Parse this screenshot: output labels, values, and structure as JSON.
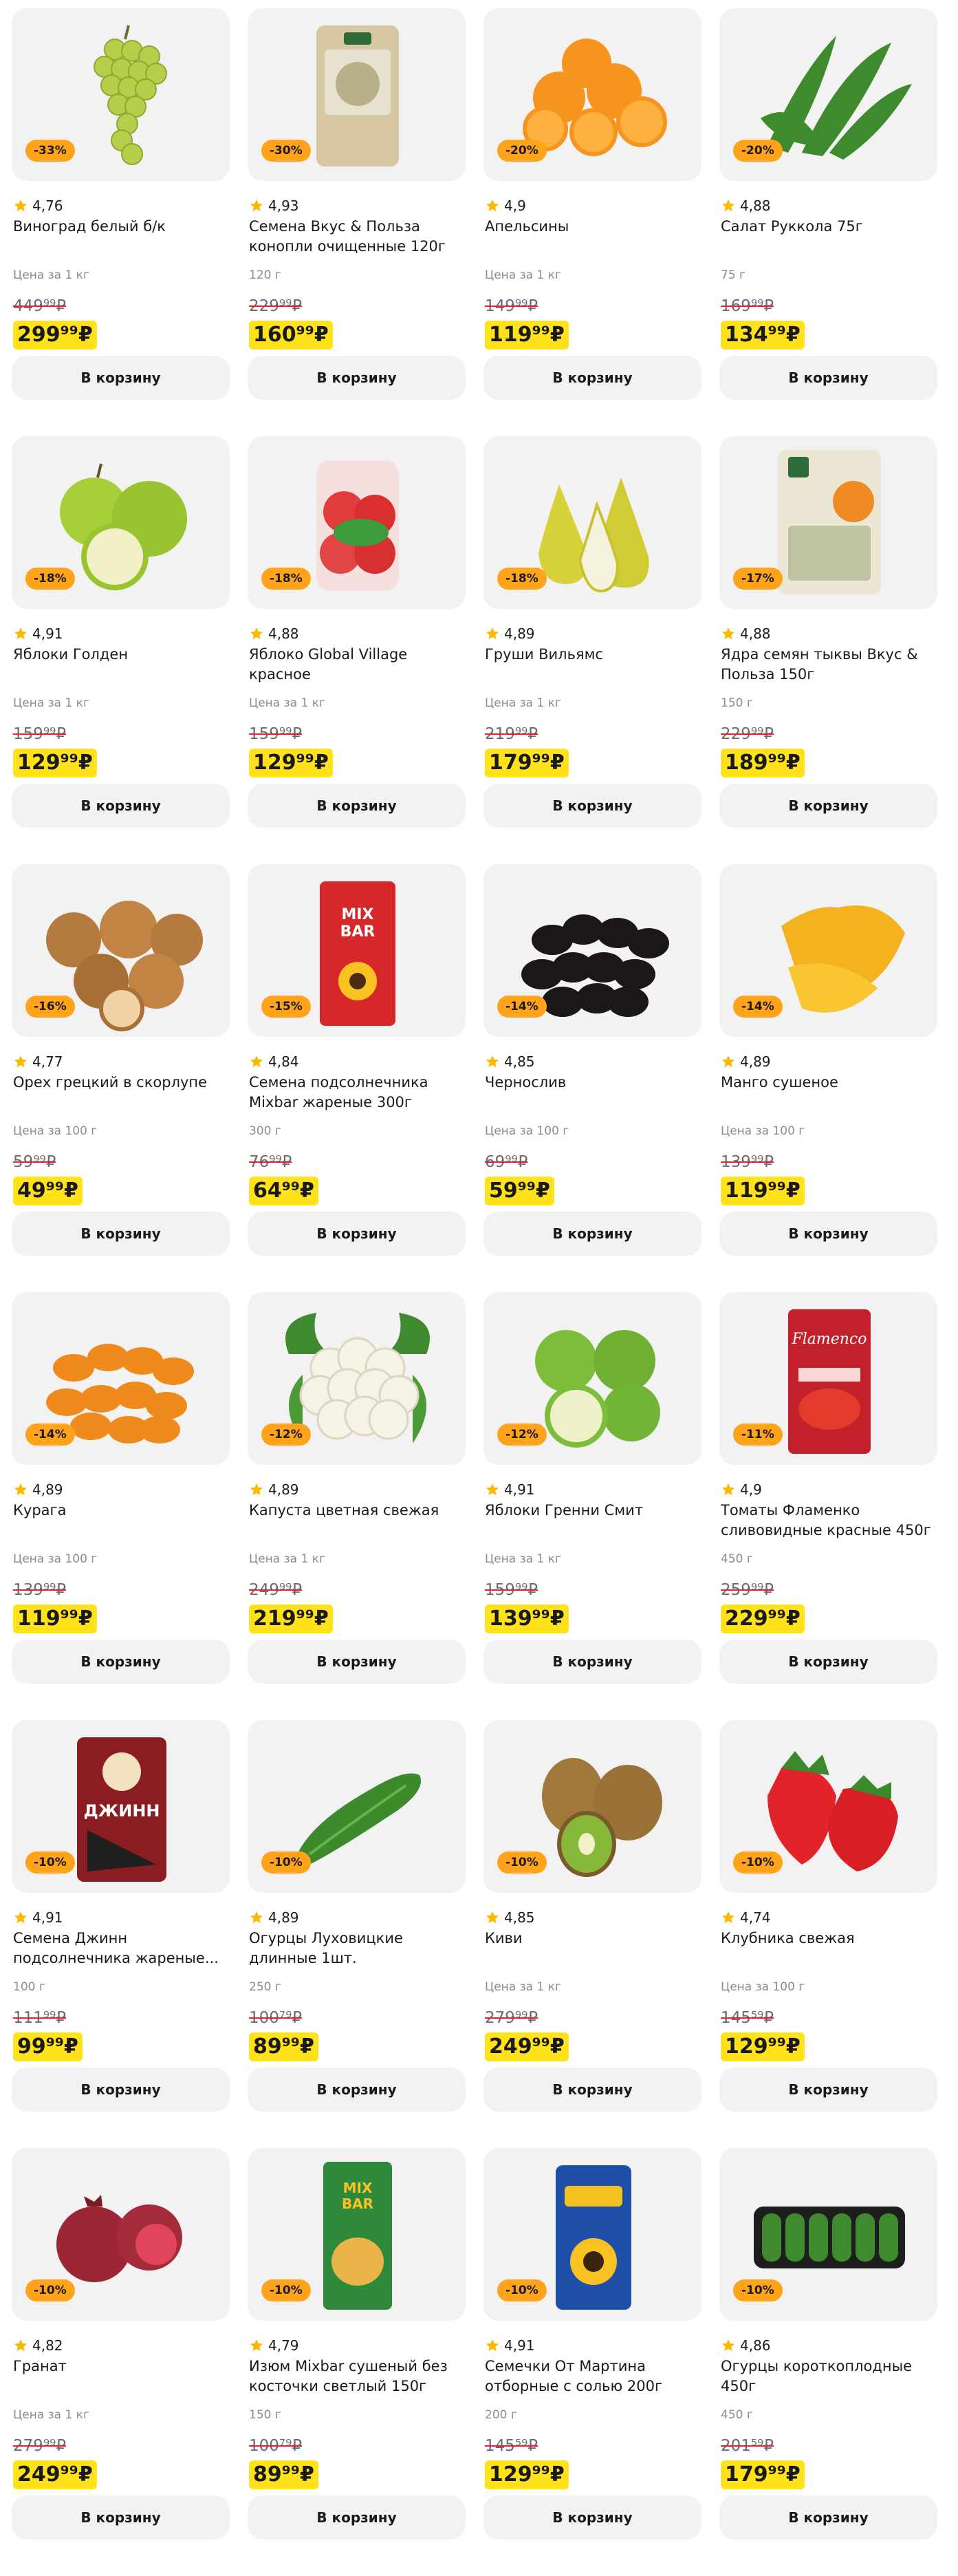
{
  "cart_label": "В корзину",
  "colors": {
    "discount": "#ffa31a",
    "price_highlight": "#ffe21a",
    "star": "#ffb800",
    "strike": "#e0262f",
    "card_bg": "#f2f2f2"
  },
  "products": [
    {
      "icon": "grapes",
      "discount": "-33%",
      "rating": "4,76",
      "title": "Виноград белый б/к",
      "unit": "Цена за 1 кг",
      "old_price": "449⁹⁹₽",
      "new_price": "299⁹⁹₽"
    },
    {
      "icon": "seed-pack",
      "discount": "-30%",
      "rating": "4,93",
      "title": "Семена Вкус & Польза конопли очищенные 120г",
      "unit": "120 г",
      "old_price": "229⁹⁹₽",
      "new_price": "160⁹⁹₽"
    },
    {
      "icon": "oranges",
      "discount": "-20%",
      "rating": "4,9",
      "title": "Апельсины",
      "unit": "Цена за 1 кг",
      "old_price": "149⁹⁹₽",
      "new_price": "119⁹⁹₽"
    },
    {
      "icon": "arugula",
      "discount": "-20%",
      "rating": "4,88",
      "title": "Салат Руккола 75г",
      "unit": "75 г",
      "old_price": "169⁹⁹₽",
      "new_price": "134⁹⁹₽"
    },
    {
      "icon": "green-apples",
      "discount": "-18%",
      "rating": "4,91",
      "title": "Яблоки Голден",
      "unit": "Цена за 1 кг",
      "old_price": "159⁹⁹₽",
      "new_price": "129⁹⁹₽"
    },
    {
      "icon": "red-apples-bag",
      "discount": "-18%",
      "rating": "4,88",
      "title": "Яблоко Global Village красное",
      "unit": "Цена за 1 кг",
      "old_price": "159⁹⁹₽",
      "new_price": "129⁹⁹₽"
    },
    {
      "icon": "pears",
      "discount": "-18%",
      "rating": "4,89",
      "title": "Груши Вильямс",
      "unit": "Цена за 1 кг",
      "old_price": "219⁹⁹₽",
      "new_price": "179⁹⁹₽"
    },
    {
      "icon": "pumpkin-seed-pack",
      "discount": "-17%",
      "rating": "4,88",
      "title": "Ядра семян тыквы Вкус & Польза 150г",
      "unit": "150 г",
      "old_price": "229⁹⁹₽",
      "new_price": "189⁹⁹₽"
    },
    {
      "icon": "walnuts",
      "discount": "-16%",
      "rating": "4,77",
      "title": "Орех грецкий в скорлупе",
      "unit": "Цена за 100 г",
      "old_price": "59⁹⁹₽",
      "new_price": "49⁹⁹₽"
    },
    {
      "icon": "mixbar-red-pack",
      "discount": "-15%",
      "rating": "4,84",
      "title": "Семена подсолнечника Mixbar жареные 300г",
      "unit": "300 г",
      "old_price": "76⁹⁹₽",
      "new_price": "64⁹⁹₽"
    },
    {
      "icon": "prunes",
      "discount": "-14%",
      "rating": "4,85",
      "title": "Чернослив",
      "unit": "Цена за 100 г",
      "old_price": "69⁹⁹₽",
      "new_price": "59⁹⁹₽"
    },
    {
      "icon": "dried-mango",
      "discount": "-14%",
      "rating": "4,89",
      "title": "Манго сушеное",
      "unit": "Цена за 100 г",
      "old_price": "139⁹⁹₽",
      "new_price": "119⁹⁹₽"
    },
    {
      "icon": "dried-apricots",
      "discount": "-14%",
      "rating": "4,89",
      "title": "Курага",
      "unit": "Цена за 100 г",
      "old_price": "139⁹⁹₽",
      "new_price": "119⁹⁹₽"
    },
    {
      "icon": "cauliflower",
      "discount": "-12%",
      "rating": "4,89",
      "title": "Капуста цветная свежая",
      "unit": "Цена за 1 кг",
      "old_price": "249⁹⁹₽",
      "new_price": "219⁹⁹₽"
    },
    {
      "icon": "granny-apples",
      "discount": "-12%",
      "rating": "4,91",
      "title": "Яблоки Гренни Смит",
      "unit": "Цена за 1 кг",
      "old_price": "159⁹⁹₽",
      "new_price": "139⁹⁹₽"
    },
    {
      "icon": "tomato-pack",
      "discount": "-11%",
      "rating": "4,9",
      "title": "Томаты Фламенко сливовидные красные 450г",
      "unit": "450 г",
      "old_price": "259⁹⁹₽",
      "new_price": "229⁹⁹₽"
    },
    {
      "icon": "djinn-seed-pack",
      "discount": "-10%",
      "rating": "4,91",
      "title": "Семена Джинн подсолнечника жареные...",
      "unit": "100 г",
      "old_price": "111⁹⁹₽",
      "new_price": "99⁹⁹₽"
    },
    {
      "icon": "cucumber",
      "discount": "-10%",
      "rating": "4,89",
      "title": "Огурцы Луховицкие длинные 1шт.",
      "unit": "250 г",
      "old_price": "100⁷⁹₽",
      "new_price": "89⁹⁹₽"
    },
    {
      "icon": "kiwi",
      "discount": "-10%",
      "rating": "4,85",
      "title": "Киви",
      "unit": "Цена за 1 кг",
      "old_price": "279⁹⁹₽",
      "new_price": "249⁹⁹₽"
    },
    {
      "icon": "strawberries",
      "discount": "-10%",
      "rating": "4,74",
      "title": "Клубника свежая",
      "unit": "Цена за 100 г",
      "old_price": "145⁵⁹₽",
      "new_price": "129⁹⁹₽"
    },
    {
      "icon": "pomegranate",
      "discount": "-10%",
      "rating": "4,82",
      "title": "Гранат",
      "unit": "Цена за 1 кг",
      "old_price": "279⁹⁹₽",
      "new_price": "249⁹⁹₽"
    },
    {
      "icon": "mixbar-raisin-pack",
      "discount": "-10%",
      "rating": "4,79",
      "title": "Изюм Mixbar сушеный без косточки светлый 150г",
      "unit": "150 г",
      "old_price": "100⁷⁹₽",
      "new_price": "89⁹⁹₽"
    },
    {
      "icon": "martin-seed-pack",
      "discount": "-10%",
      "rating": "4,91",
      "title": "Семечки От Мартина отборные с солью 200г",
      "unit": "200 г",
      "old_price": "145⁵⁹₽",
      "new_price": "129⁹⁹₽"
    },
    {
      "icon": "cucumber-tray",
      "discount": "-10%",
      "rating": "4,86",
      "title": "Огурцы короткоплодные 450г",
      "unit": "450 г",
      "old_price": "201⁵⁹₽",
      "new_price": "179⁹⁹₽"
    }
  ]
}
